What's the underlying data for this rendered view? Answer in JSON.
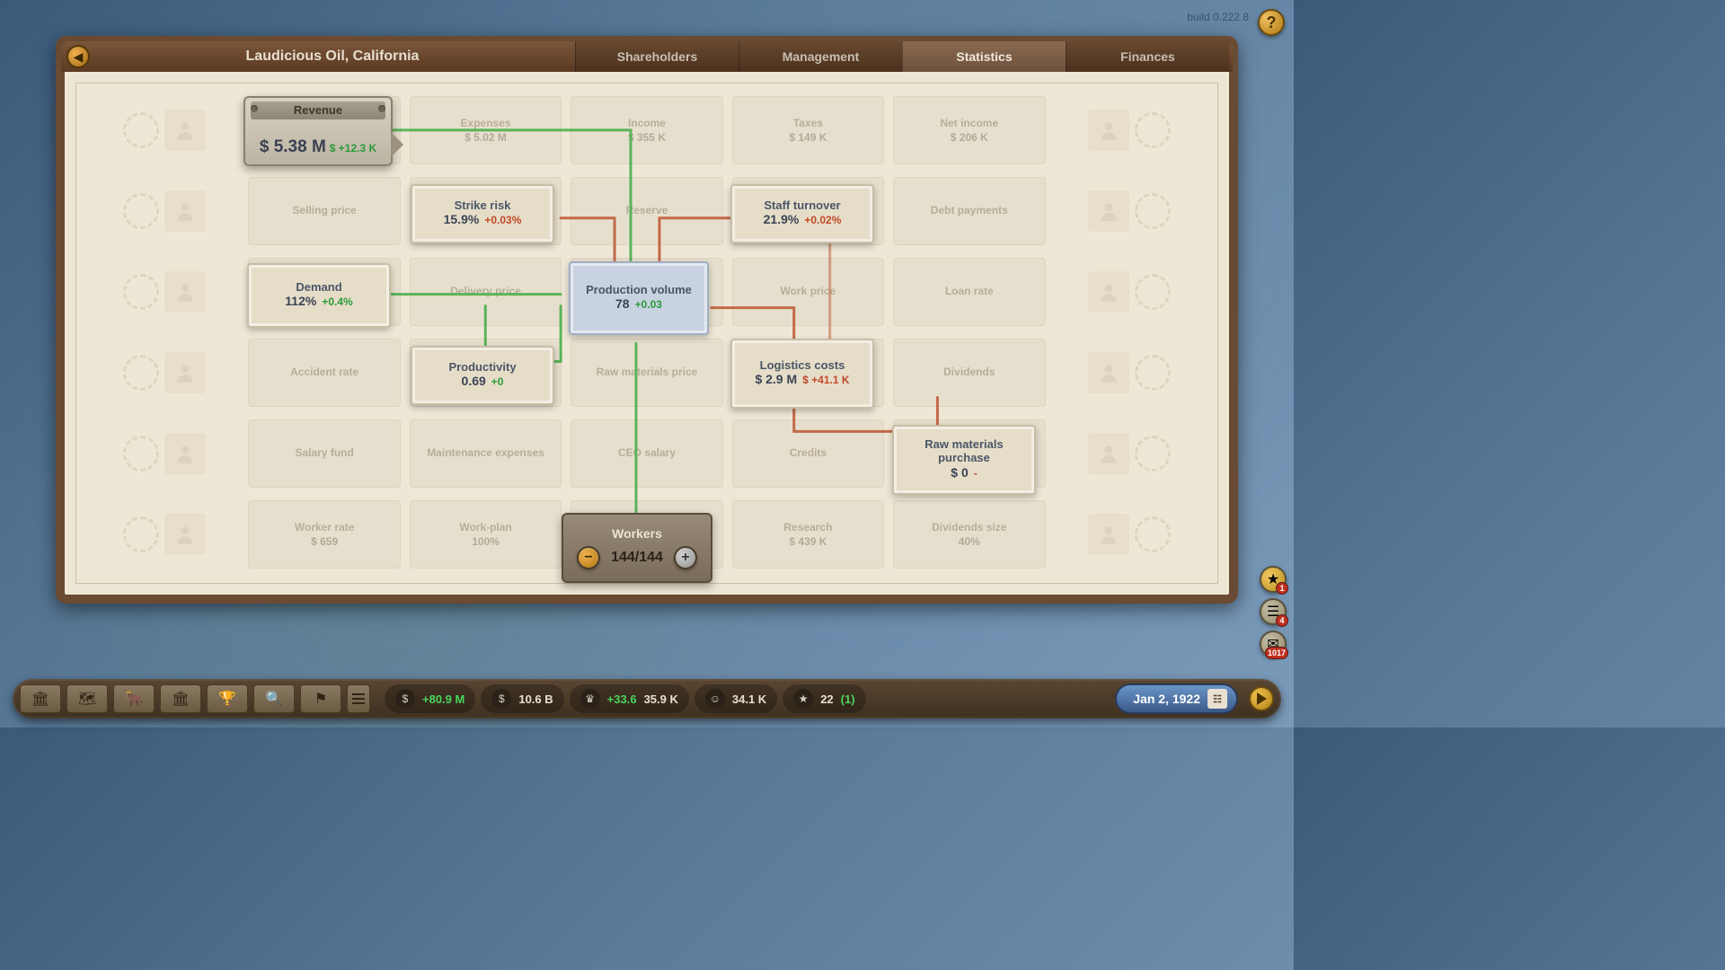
{
  "build": "build 0.222.8",
  "panel": {
    "title": "Laudicious Oil, California",
    "tabs": [
      "Shareholders",
      "Management",
      "Statistics",
      "Finances"
    ],
    "active_tab": 2
  },
  "top_row": {
    "revenue": {
      "label": "Revenue",
      "value": "$ 5.38 M",
      "delta": "$ +12.3 K"
    },
    "expenses": {
      "label": "Expenses",
      "value": "$ 5.02 M"
    },
    "income": {
      "label": "Income",
      "value": "$ 355 K"
    },
    "taxes": {
      "label": "Taxes",
      "value": "$ 149 K"
    },
    "net_income": {
      "label": "Net income",
      "value": "$ 206 K"
    }
  },
  "bg_cards": {
    "r2": [
      "Selling price",
      "",
      "Reserve",
      "",
      "Debt payments"
    ],
    "r3": [
      "",
      "Delivery price",
      "",
      "Work price",
      "Loan rate"
    ],
    "r4": [
      "Accident rate",
      "",
      "Raw materials price",
      "",
      "Dividends"
    ],
    "r5": [
      "Salary fund",
      "Maintenance expenses",
      "CEO salary",
      "Credits",
      ""
    ],
    "r6": [
      {
        "label": "Worker rate",
        "value": "$ 659"
      },
      {
        "label": "Work-plan",
        "value": "100%"
      },
      {
        "label": "",
        "value": ""
      },
      {
        "label": "Research",
        "value": "$ 439 K"
      },
      {
        "label": "Dividends size",
        "value": "40%"
      }
    ]
  },
  "nodes": {
    "strike": {
      "label": "Strike risk",
      "value": "15.9%",
      "delta": "+0.03%",
      "delta_kind": "red"
    },
    "turnover": {
      "label": "Staff turnover",
      "value": "21.9%",
      "delta": "+0.02%",
      "delta_kind": "red"
    },
    "demand": {
      "label": "Demand",
      "value": "112%",
      "delta": "+0.4%",
      "delta_kind": "green"
    },
    "production": {
      "label": "Production volume",
      "value": "78",
      "delta": "+0.03",
      "delta_kind": "green"
    },
    "productivity": {
      "label": "Productivity",
      "value": "0.69",
      "delta": "+0",
      "delta_kind": "green"
    },
    "logistics": {
      "label": "Logistics costs",
      "value": "$ 2.9 M",
      "delta": "$ +41.1 K",
      "delta_kind": "red"
    },
    "raw": {
      "label": "Raw materials purchase",
      "value": "$ 0",
      "delta": "-",
      "delta_kind": ""
    },
    "workers": {
      "label": "Workers",
      "value": "144/144"
    }
  },
  "hud": {
    "stats": {
      "cash_delta": "+80.9 M",
      "cash": "10.6 B",
      "crown_delta": "+33.6",
      "crown": "35.9 K",
      "people": "34.1 K",
      "star": "22",
      "star_extra": "(1)"
    },
    "date": "Jan 2, 1922"
  },
  "notifs": {
    "star": "1",
    "news": "4",
    "mail": "1017"
  }
}
